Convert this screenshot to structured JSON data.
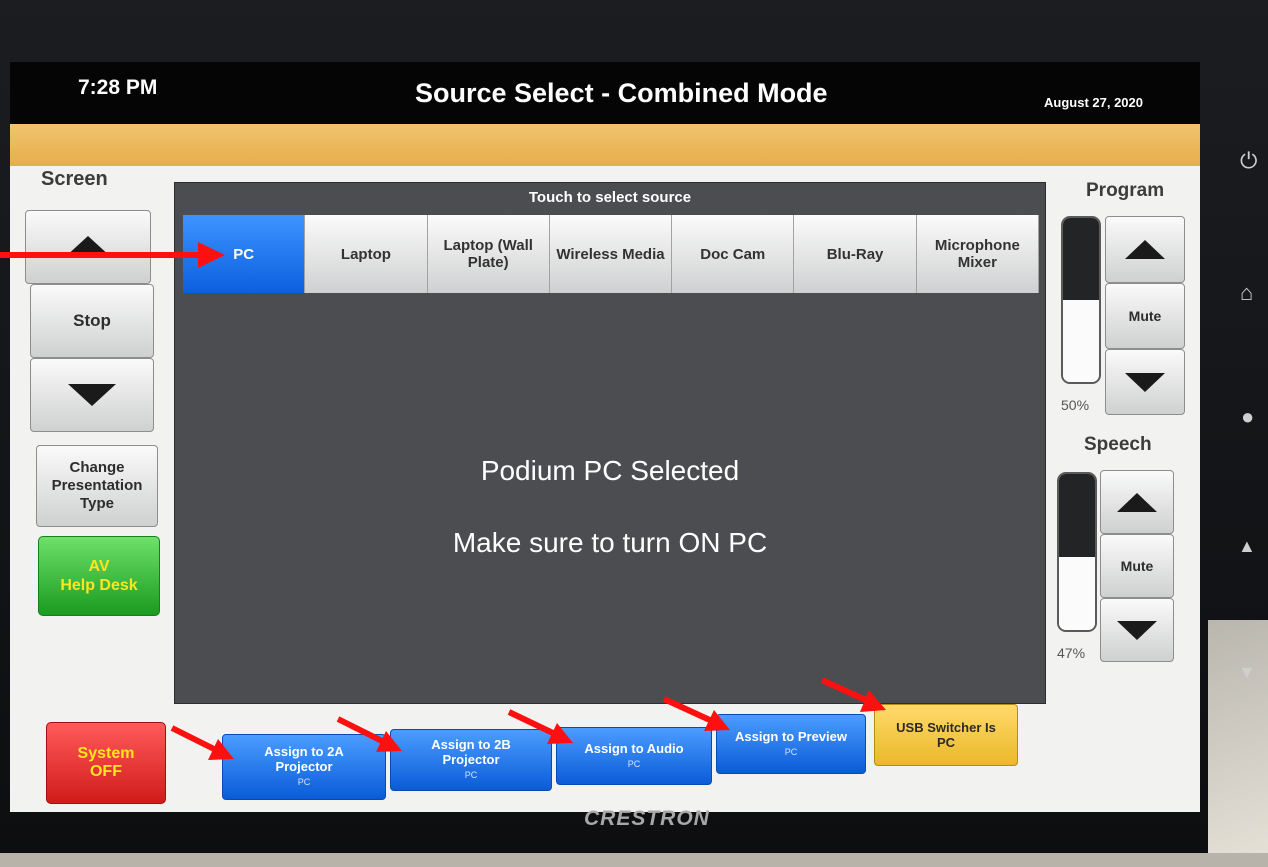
{
  "header": {
    "time": "7:28 PM",
    "title": "Source Select - Combined Mode",
    "date": "August 27, 2020"
  },
  "screen_controls": {
    "label": "Screen",
    "stop_label": "Stop",
    "change_presentation_label": "Change Presentation Type",
    "av_help_label_1": "AV",
    "av_help_label_2": "Help Desk",
    "system_off_label_1": "System",
    "system_off_label_2": "OFF"
  },
  "source_panel": {
    "header": "Touch to select source",
    "sources": [
      {
        "label": "PC",
        "selected": true
      },
      {
        "label": "Laptop",
        "selected": false
      },
      {
        "label": "Laptop (Wall Plate)",
        "selected": false
      },
      {
        "label": "Wireless Media",
        "selected": false
      },
      {
        "label": "Doc Cam",
        "selected": false
      },
      {
        "label": "Blu-Ray",
        "selected": false
      },
      {
        "label": "Microphone Mixer",
        "selected": false
      }
    ],
    "message_primary": "Podium PC Selected",
    "message_secondary": "Make sure to turn ON PC"
  },
  "program": {
    "label": "Program",
    "mute_label": "Mute",
    "level_percent": 50,
    "level_text": "50%"
  },
  "speech": {
    "label": "Speech",
    "mute_label": "Mute",
    "level_percent": 47,
    "level_text": "47%"
  },
  "bottom_actions": {
    "assign_2a": {
      "label": "Assign to 2A Projector",
      "sub": "PC"
    },
    "assign_2b": {
      "label": "Assign to 2B Projector",
      "sub": "PC"
    },
    "assign_audio": {
      "label": "Assign to Audio",
      "sub": "PC"
    },
    "assign_preview": {
      "label": "Assign to Preview",
      "sub": "PC"
    },
    "usb_switcher": {
      "label": "USB Switcher Is PC"
    }
  },
  "brand": "CRESTRON",
  "colors": {
    "selected_source": "#1a72f0",
    "orange_bar": "#ecb75a",
    "annotation_arrow": "#ff1010",
    "usb_button": "#f5c84a",
    "help_button": "#36b836",
    "system_off": "#e42828"
  }
}
